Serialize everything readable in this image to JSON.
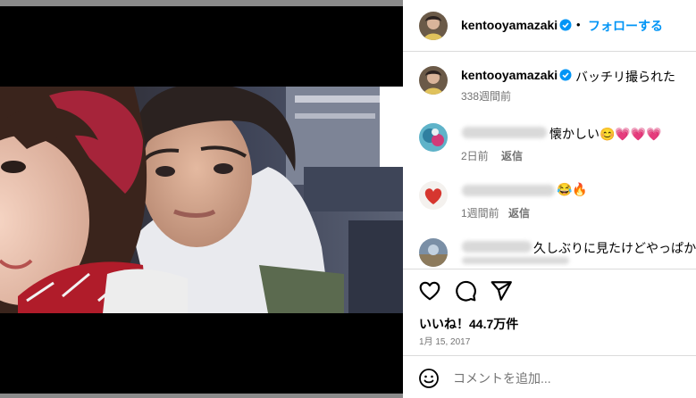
{
  "post": {
    "author": "kentooyamazaki",
    "follow_label": "フォローする",
    "separator": "•"
  },
  "caption": {
    "username": "kentooyamazaki",
    "text": "バッチリ撮られた",
    "time": "338週間前"
  },
  "comments": [
    {
      "text": "懐かしい😊💗💗💗",
      "time": "2日前",
      "reply": "返信"
    },
    {
      "text": "😂🔥",
      "time": "1週間前",
      "reply": "返信"
    },
    {
      "text": "久しぶりに見たけどやっぱかっ"
    }
  ],
  "actions": {
    "like_icon": "heart-outline",
    "comment_icon": "speech-bubble",
    "share_icon": "paper-plane"
  },
  "likes": "いいね！44.7万件",
  "date": "1月 15, 2017",
  "comment_box": {
    "placeholder": "コメントを追加..."
  },
  "colors": {
    "accent": "#0095f6",
    "verified": "#0095f6",
    "secondary_text": "#737373",
    "divider": "#dbdbdb"
  }
}
